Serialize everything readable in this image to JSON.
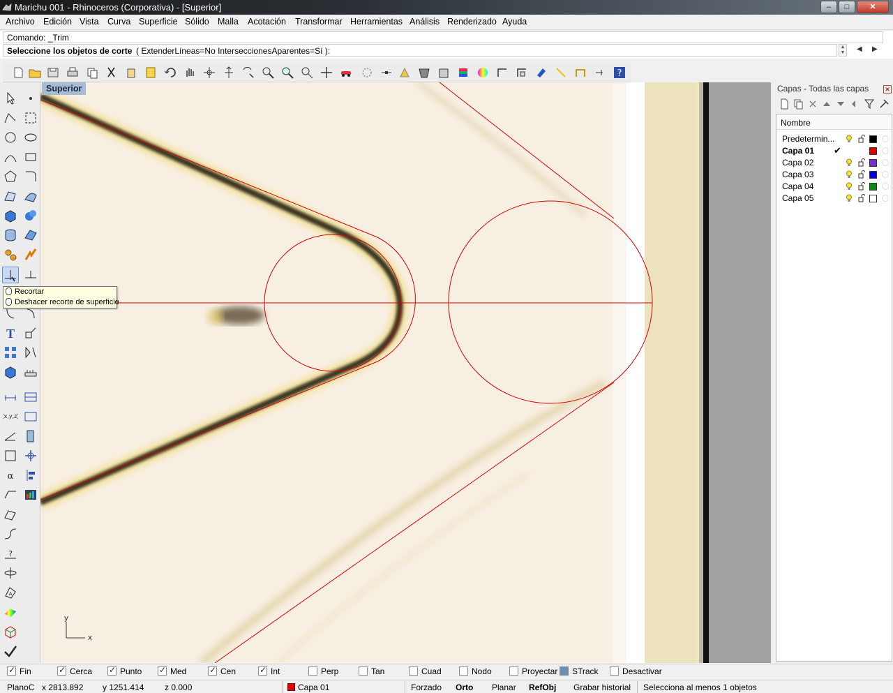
{
  "window": {
    "title": "Marichu 001 - Rhinoceros (Corporativa) - [Superior]",
    "minimize": "–",
    "maximize": "□",
    "close": "✕"
  },
  "menu": [
    "Archivo",
    "Edición",
    "Vista",
    "Curva",
    "Superficie",
    "Sólido",
    "Malla",
    "Acotación",
    "Transformar",
    "Herramientas",
    "Análisis",
    "Renderizado",
    "Ayuda"
  ],
  "command": {
    "history": "Comando: _Trim",
    "prompt": "Seleccione los objetos de corte",
    "options": "( ExtenderLíneas=No  IntersecionesAparentes=Sí ):",
    "options_display": "( ExtenderLíneas=No  InterseccionesAparentes=Sí ):"
  },
  "viewport": {
    "title": "Superior",
    "axis_y": "y",
    "axis_x": "x"
  },
  "tooltip": {
    "items": [
      "Recortar",
      "Deshacer recorte de superficie"
    ]
  },
  "layers_panel": {
    "title": "Capas - Todas las capas",
    "column_name": "Nombre",
    "layers": [
      {
        "name": "Predetermin...",
        "color": "#000000",
        "current": false
      },
      {
        "name": "Capa 01",
        "color": "#e00000",
        "current": true
      },
      {
        "name": "Capa 02",
        "color": "#7a2bd1",
        "current": false
      },
      {
        "name": "Capa 03",
        "color": "#0000e0",
        "current": false
      },
      {
        "name": "Capa 04",
        "color": "#0a8a0a",
        "current": false
      },
      {
        "name": "Capa 05",
        "color": "#ffffff",
        "current": false
      }
    ],
    "current_mark": "✔"
  },
  "osnaps": [
    {
      "label": "Fin",
      "checked": true
    },
    {
      "label": "Cerca",
      "checked": true
    },
    {
      "label": "Punto",
      "checked": true
    },
    {
      "label": "Med",
      "checked": true
    },
    {
      "label": "Cen",
      "checked": true
    },
    {
      "label": "Int",
      "checked": true
    },
    {
      "label": "Perp",
      "checked": false
    },
    {
      "label": "Tan",
      "checked": false
    },
    {
      "label": "Cuad",
      "checked": false
    },
    {
      "label": "Nodo",
      "checked": false
    },
    {
      "label": "Proyectar",
      "checked": false
    },
    {
      "label": "STrack",
      "checked": false
    },
    {
      "label": "Desactivar",
      "checked": false
    }
  ],
  "status": {
    "cplane": "PlanoC",
    "x": "x 2813.892",
    "y": "y 1251.414",
    "z": "z 0.000",
    "layer": "Capa 01",
    "forzado": "Forzado",
    "orto": "Orto",
    "planar": "Planar",
    "refobj": "RefObj",
    "grabar": "Grabar historial",
    "message": "Selecciona al menos 1 objetos"
  }
}
